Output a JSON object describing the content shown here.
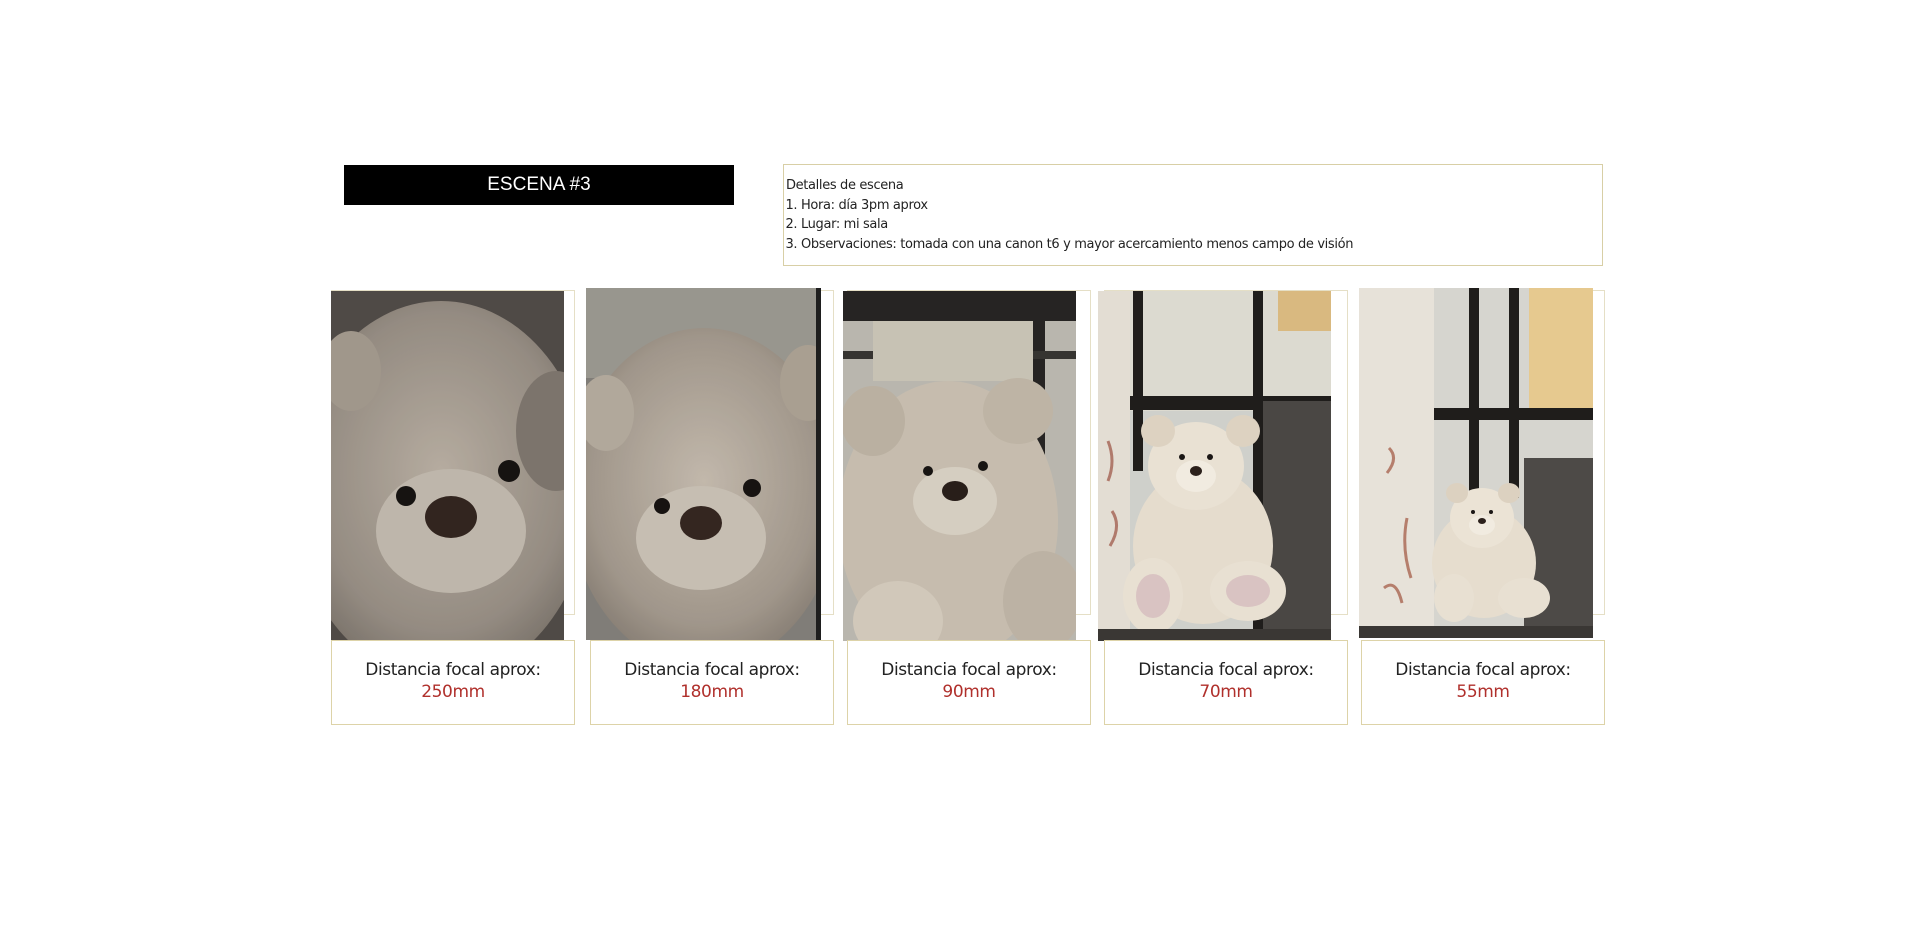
{
  "scene": {
    "title": "ESCENA #3"
  },
  "details": {
    "heading": "Detalles de escena",
    "items": [
      "Hora: día  3pm aprox",
      "Lugar: mi sala",
      "Observaciones: tomada con una canon t6 y mayor acercamiento menos campo de visión"
    ]
  },
  "shots": [
    {
      "label": "Distancia focal aprox:",
      "value": "250mm",
      "image": "teddy-bear-closeup-photo"
    },
    {
      "label": "Distancia focal aprox:",
      "value": "180mm",
      "image": "teddy-bear-close-photo"
    },
    {
      "label": "Distancia focal aprox:",
      "value": "90mm",
      "image": "teddy-bear-medium-photo"
    },
    {
      "label": "Distancia focal aprox:",
      "value": "70mm",
      "image": "teddy-bear-window-photo"
    },
    {
      "label": "Distancia focal aprox:",
      "value": "55mm",
      "image": "teddy-bear-wide-photo"
    }
  ],
  "colors": {
    "title_bg": "#000000",
    "value_text": "#b0302c",
    "border": "#d8cfa6"
  }
}
